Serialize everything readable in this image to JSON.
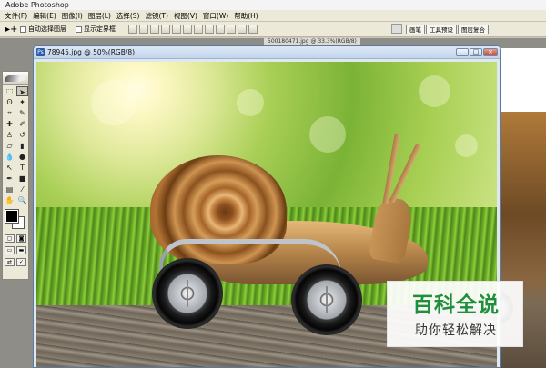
{
  "app": {
    "title": "Adobe Photoshop"
  },
  "menu": [
    "文件(F)",
    "编辑(E)",
    "图像(I)",
    "图层(L)",
    "选择(S)",
    "滤镜(T)",
    "视图(V)",
    "窗口(W)",
    "帮助(H)"
  ],
  "options": {
    "auto_select": "自动选择图层",
    "show_bounds": "显示定界框"
  },
  "palette_well": [
    "画笔",
    "工具预设",
    "图层复合"
  ],
  "background_doc": {
    "title": "500180471.jpg @ 33.3%(RGB/8)"
  },
  "document": {
    "title": "78945.jpg @ 50%(RGB/8)"
  },
  "window_controls": {
    "minimize": "_",
    "maximize": "□",
    "close": "×"
  },
  "watermark": {
    "title": "百科全说",
    "subtitle": "助你轻松解决"
  },
  "colors": {
    "watermark_green": "#1f8f3c",
    "title_bar_blue": "#c2d5ec",
    "foreground": "#000000",
    "background": "#ffffff"
  },
  "icons": {
    "move_tool": "move-icon",
    "marquee": "marquee-icon",
    "lasso": "lasso-icon",
    "wand": "magic-wand-icon",
    "crop": "crop-icon",
    "brush": "brush-icon",
    "text": "text-icon",
    "hand": "hand-icon",
    "zoom": "zoom-icon"
  }
}
